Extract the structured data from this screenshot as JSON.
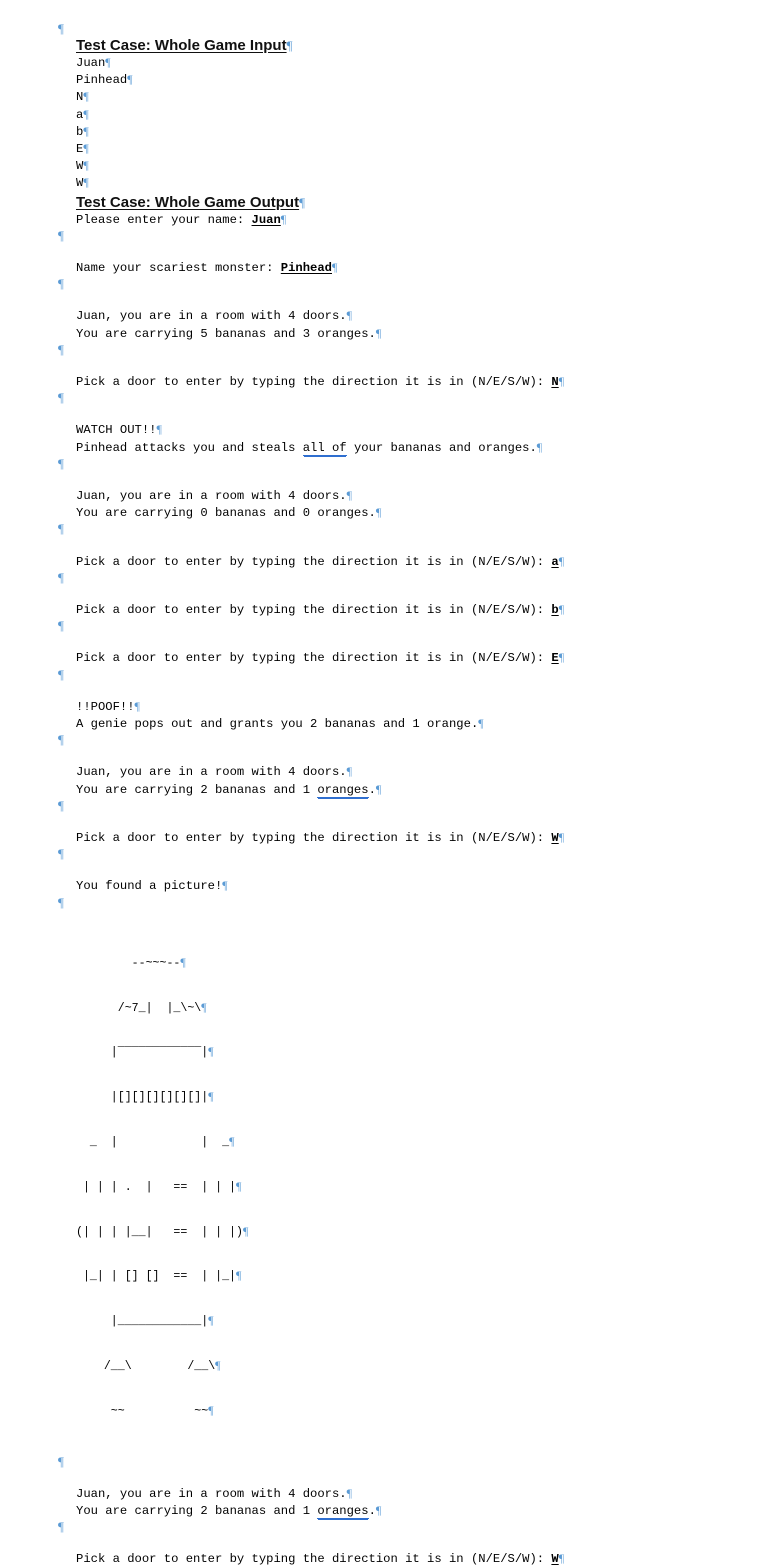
{
  "document": {
    "formatting_mark": "¶",
    "pilcrow_color": "#5b9bd5",
    "grammar_underline_color": "#2f6fd0"
  },
  "sections": {
    "input_heading": "Test Case: Whole Game Input",
    "output_heading": "Test Case: Whole Game Output"
  },
  "input_lines": [
    "Juan",
    "Pinhead",
    "N",
    "a",
    "b",
    "E",
    "W",
    "W"
  ],
  "output": {
    "prompt_name_label": "Please enter your name: ",
    "prompt_name_value": "Juan",
    "prompt_monster_label": "Name your scariest monster: ",
    "prompt_monster_value": "Pinhead",
    "room_line": "Juan, you are in a room with 4 doors.",
    "carrying_1_pre": "You are carrying 5 bananas and 3 oranges.",
    "door_prompt": "Pick a door to enter by typing the direction it is in (N/E/S/W): ",
    "door_answer_1": "N",
    "watch_out": "WATCH OUT!!",
    "attack_pre": "Pinhead attacks you and steals ",
    "attack_grammar": "all of",
    "attack_post": " your bananas and oranges.",
    "carrying_zero": "You are carrying 0 bananas and 0 oranges.",
    "door_answer_2": "a",
    "door_answer_3": "b",
    "door_answer_4": "E",
    "poof": "!!POOF!!",
    "genie": "A genie pops out and grants you 2 bananas and 1 orange.",
    "carrying_two_pre": "You are carrying 2 bananas and 1 ",
    "carrying_two_grammar": "oranges",
    "carrying_two_post": ".",
    "door_answer_5": "W",
    "found_picture": "You found a picture!",
    "door_answer_6": "W"
  },
  "ascii_art": {
    "name": "robot-picture",
    "lines": [
      "        --~~~--",
      "      /~7_|  |_\\~\\",
      "     |‾‾‾‾‾‾‾‾‾‾‾‾|",
      "     |[][][][][][]|",
      "  _  |            |  _",
      " | | | .  |   ==  | | |",
      "(| | | |__|   ==  | | |)",
      " |_| | [] []  ==  | |_|",
      "     |____________|",
      "    /__\\        /__\\",
      "     ~~          ~~"
    ]
  }
}
